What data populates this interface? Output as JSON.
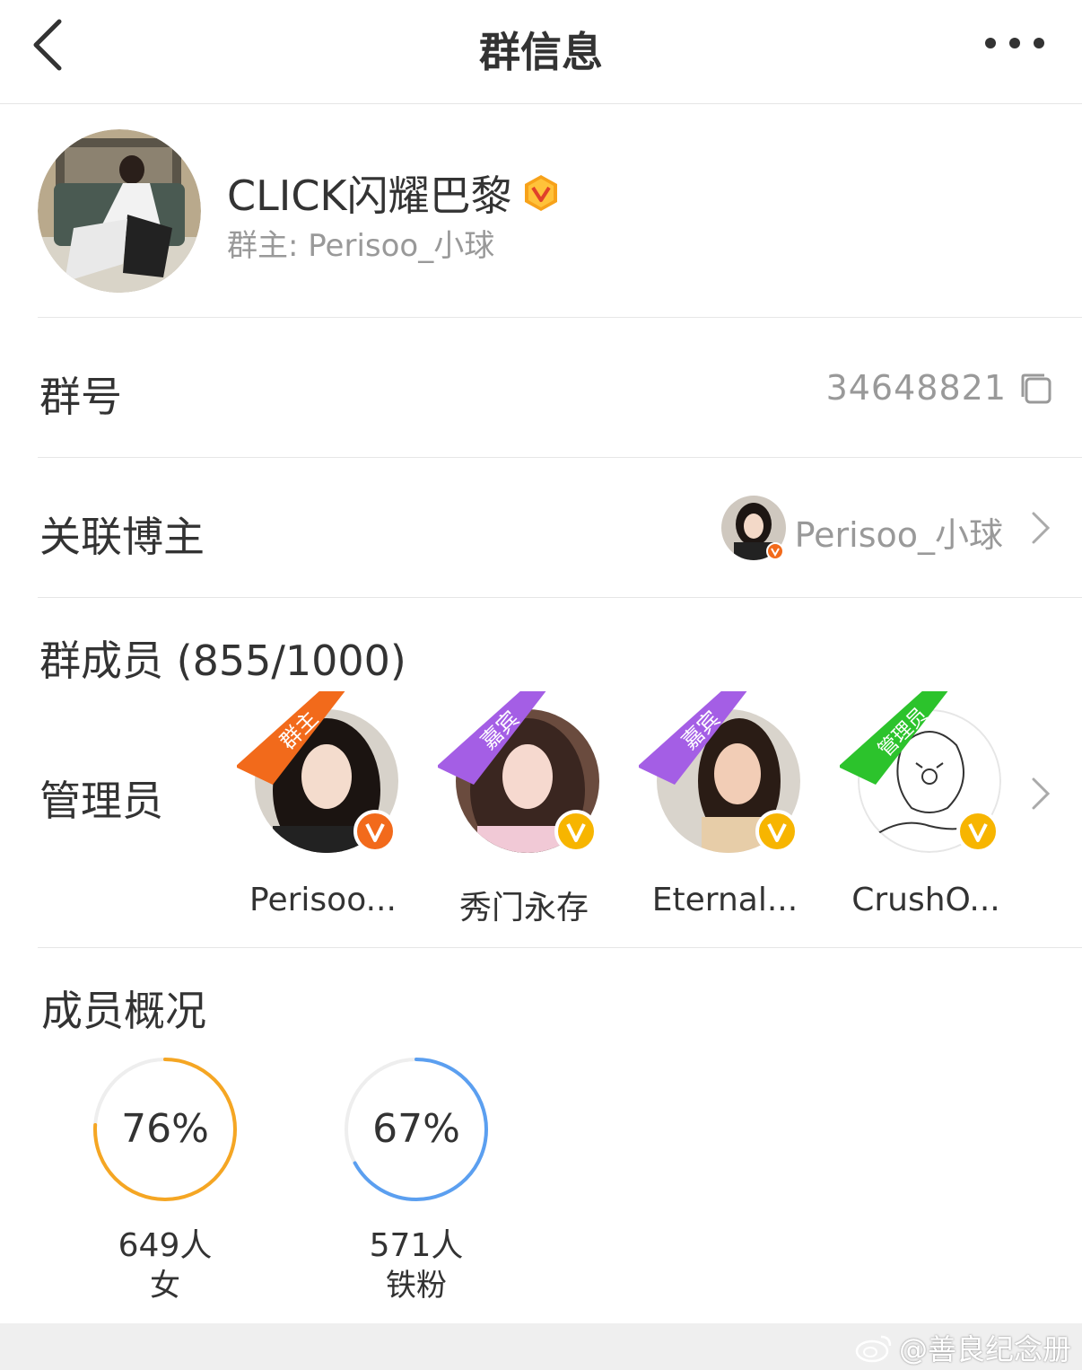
{
  "nav": {
    "title": "群信息",
    "back_icon": "chevron-left-icon",
    "more_icon": "more-dots-icon"
  },
  "group": {
    "name": "CLICK闪耀巴黎",
    "owner_text": "群主: Perisoo_小球",
    "badge_icon": "verified-v-icon",
    "badge_color": "#f7a21a"
  },
  "group_id": {
    "label": "群号",
    "value": "34648821",
    "icon": "copy-icon"
  },
  "linked_blogger": {
    "label": "关联博主",
    "name": "Perisoo_小球"
  },
  "members": {
    "title": "群成员 (855/1000)",
    "admins_label": "管理员",
    "admins": [
      {
        "name": "Perisoo...",
        "ribbon": "群主",
        "ribbon_color": "#f26a1b",
        "badge_color": "#f26a1b"
      },
      {
        "name": "秀门永存",
        "ribbon": "嘉宾",
        "ribbon_color": "#a45ee5",
        "badge_color": "#f7b500"
      },
      {
        "name": "Eternal...",
        "ribbon": "嘉宾",
        "ribbon_color": "#a45ee5",
        "badge_color": "#f7b500"
      },
      {
        "name": "CrushO...",
        "ribbon": "管理员",
        "ribbon_color": "#2cc32c",
        "badge_color": "#f7b500"
      }
    ]
  },
  "overview": {
    "title": "成员概况",
    "stats": [
      {
        "percent": 76,
        "percent_text": "76%",
        "count": "649人",
        "desc": "女",
        "color": "#f5a623"
      },
      {
        "percent": 67,
        "percent_text": "67%",
        "count": "571人",
        "desc": "铁粉",
        "color": "#5b9ff0"
      }
    ]
  },
  "watermark": {
    "text": "@善良纪念册",
    "icon": "weibo-logo-icon"
  }
}
